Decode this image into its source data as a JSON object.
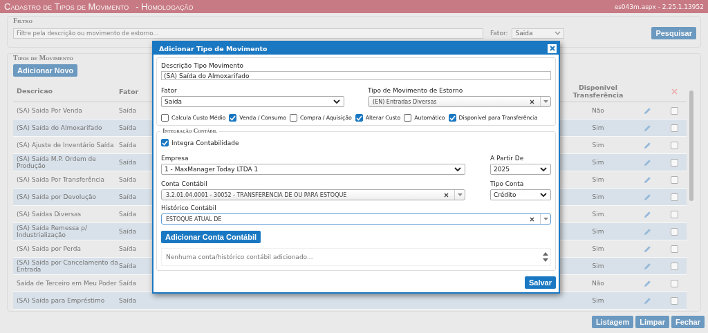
{
  "header": {
    "title": "Cadastro de Tipos de Movimento",
    "environment": "- Homologação",
    "version": "es043m.aspx - 2.25.1.13952"
  },
  "filter": {
    "legend": "Filtro",
    "search": {
      "placeholder": "Filtre pela descrição ou movimento de estorno..."
    },
    "fator_label": "Fator:",
    "fator_value": "Saida",
    "search_button": "Pesquisar"
  },
  "list": {
    "legend": "Tipos de Movimento",
    "add_button": "Adicionar Novo",
    "columns": [
      "Descricao",
      "Fator",
      "Disponivel Transferência"
    ],
    "rows": [
      {
        "description": "(SA) Saida Por Venda",
        "fator": "Saída",
        "available": "Não",
        "checked": false
      },
      {
        "description": "(SA) Saída do Almoxarifado",
        "fator": "Saída",
        "available": "Sim",
        "checked": false
      },
      {
        "description": "(SA) Ajuste de Inventário Saída",
        "fator": "Saída",
        "available": "Sim",
        "checked": false
      },
      {
        "description": "(SA) Saída M.P. Ordem de Produção",
        "fator": "Saída",
        "available": "Sim",
        "checked": false
      },
      {
        "description": "(SA) Saída Por Transferência",
        "fator": "Saída",
        "available": "Sim",
        "checked": false
      },
      {
        "description": "(SA) Saída por Devolução",
        "fator": "Saída",
        "available": "Sim",
        "checked": false
      },
      {
        "description": "(SA) Saídas Diversas",
        "fator": "Saída",
        "available": "Sim",
        "checked": false
      },
      {
        "description": "(SA) Saída Remessa p/ Industrialização",
        "fator": "Saída",
        "available": "Sim",
        "checked": false
      },
      {
        "description": "(SA) Saída por Perda",
        "fator": "Saída",
        "available": "Sim",
        "checked": false
      },
      {
        "description": "(SA) Saída por Cancelamento da Entrada",
        "fator": "Saída",
        "available": "Sim",
        "checked": false
      },
      {
        "description": "Saída de Terceiro em Meu Poder",
        "fator": "Saída",
        "available": "Não",
        "checked": false
      },
      {
        "description": "(SA) Saída para Empréstimo",
        "fator": "Saída",
        "available": "Sim",
        "checked": false
      }
    ]
  },
  "footer_buttons": [
    "Listagem",
    "Limpar",
    "Fechar"
  ],
  "modal": {
    "title": "Adicionar Tipo de Movimento",
    "description_label": "Descrição Tipo Movimento",
    "description_value": "(SA) Saída do Almoxarifado",
    "fator_label": "Fator",
    "fator_value": "Saida",
    "estorno_label": "Tipo de Movimento de Estorno",
    "estorno_value": "(EN) Entradas Diversas",
    "options": [
      {
        "label": "Calcula Custo Médio",
        "checked": false
      },
      {
        "label": "Venda / Consumo",
        "checked": true
      },
      {
        "label": "Compra / Aquisição",
        "checked": false
      },
      {
        "label": "Alterar Custo",
        "checked": true
      },
      {
        "label": "Automático",
        "checked": false
      },
      {
        "label": "Disponível para Transferência",
        "checked": true
      }
    ],
    "integration": {
      "legend": "Integração Contábil",
      "integrate": {
        "label": "Integra Contabilidade",
        "checked": true
      },
      "empresa_label": "Empresa",
      "empresa_value": "1 - MaxManager Today LTDA 1",
      "from_label": "A Partir De",
      "from_value": "2025",
      "conta_label": "Conta Contábil",
      "conta_value": "3.2.01.04.0001 - 30052 - TRANSFERENCIA DE OU PARA ESTOQUE",
      "tipo_label": "Tipo Conta",
      "tipo_value": "Crédito",
      "historico_label": "Histórico Contábil",
      "historico_value": "ESTOQUE ATUAL DE",
      "add_button": "Adicionar Conta Contábil",
      "list_placeholder": "Nenhuma conta/histórico contábil adicionado..."
    },
    "save_button": "Salvar"
  }
}
